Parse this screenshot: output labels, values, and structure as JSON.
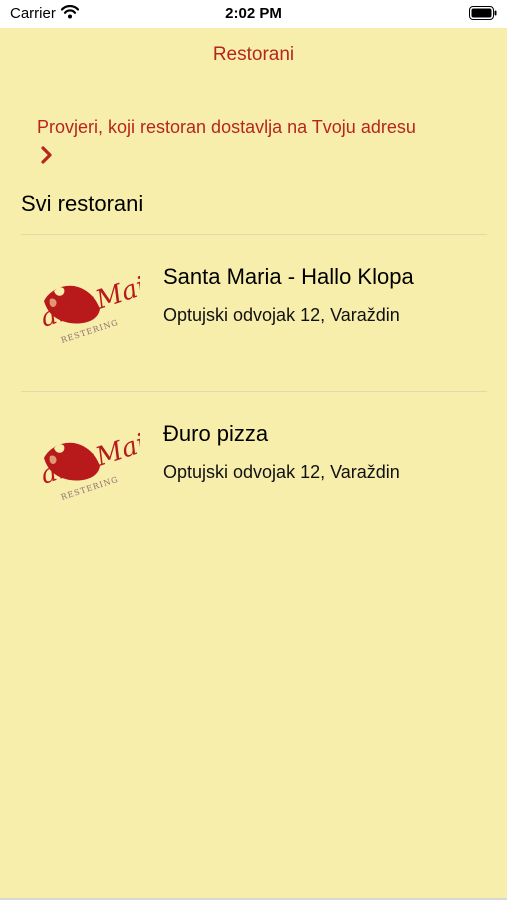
{
  "status_bar": {
    "carrier": "Carrier",
    "time": "2:02 PM"
  },
  "nav": {
    "title": "Restorani"
  },
  "delivery_check": {
    "label": "Provjeri, koji restoran dostavlja na Tvoju adresu",
    "icon": "chevron-right-icon"
  },
  "section": {
    "title": "Svi restorani"
  },
  "restaurants": [
    {
      "name": "Santa Maria - Hallo Klopa",
      "address": "Optujski odvojak 12, Varaždin",
      "logo_text": "antaMai",
      "logo_subtext": "RESTERING"
    },
    {
      "name": "Đuro pizza",
      "address": "Optujski odvojak 12, Varaždin",
      "logo_text": "antaMai",
      "logo_subtext": "RESTERING"
    }
  ],
  "colors": {
    "background": "#f8eeac",
    "accent": "#b7261d",
    "logo_red": "#b8191b"
  }
}
